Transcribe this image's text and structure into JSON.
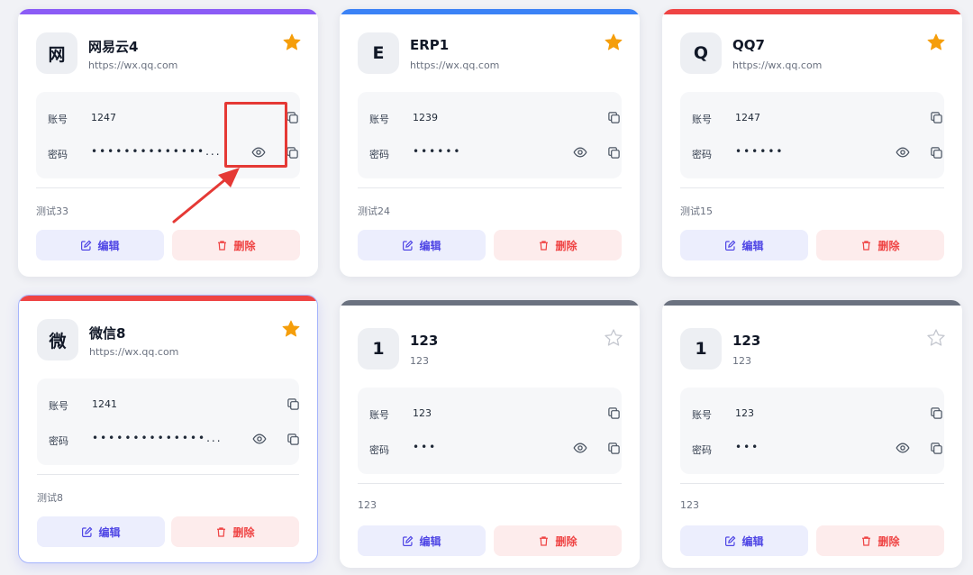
{
  "labels": {
    "account": "账号",
    "password": "密码",
    "edit": "编辑",
    "delete": "删除"
  },
  "colors": {
    "purple": "#8b5cf6",
    "blue": "#3b82f6",
    "red": "#ef4444",
    "gray": "#6b7280",
    "star": "#f59e0b"
  },
  "icons": {
    "copy": "copy-icon",
    "eye": "eye-icon",
    "star": "star-icon",
    "edit": "edit-icon",
    "trash": "trash-icon"
  },
  "cards": [
    {
      "initial": "网",
      "name": "网易云4",
      "url": "https://wx.qq.com",
      "account": "1247",
      "password_mask": "••••••••••••••...",
      "note": "测试33",
      "favorite": true,
      "accent": "#8b5cf6"
    },
    {
      "initial": "E",
      "name": "ERP1",
      "url": "https://wx.qq.com",
      "account": "1239",
      "password_mask": "••••••",
      "note": "测试24",
      "favorite": true,
      "accent": "#3b82f6"
    },
    {
      "initial": "Q",
      "name": "QQ7",
      "url": "https://wx.qq.com",
      "account": "1247",
      "password_mask": "••••••",
      "note": "测试15",
      "favorite": true,
      "accent": "#ef4444"
    },
    {
      "initial": "微",
      "name": "微信8",
      "url": "https://wx.qq.com",
      "account": "1241",
      "password_mask": "••••••••••••••...",
      "note": "测试8",
      "favorite": true,
      "accent": "#ef4444"
    },
    {
      "initial": "1",
      "name": "123",
      "url": "123",
      "account": "123",
      "password_mask": "•••",
      "note": "123",
      "favorite": false,
      "accent": "#6b7280"
    },
    {
      "initial": "1",
      "name": "123",
      "url": "123",
      "account": "123",
      "password_mask": "•••",
      "note": "123",
      "favorite": false,
      "accent": "#6b7280"
    }
  ]
}
